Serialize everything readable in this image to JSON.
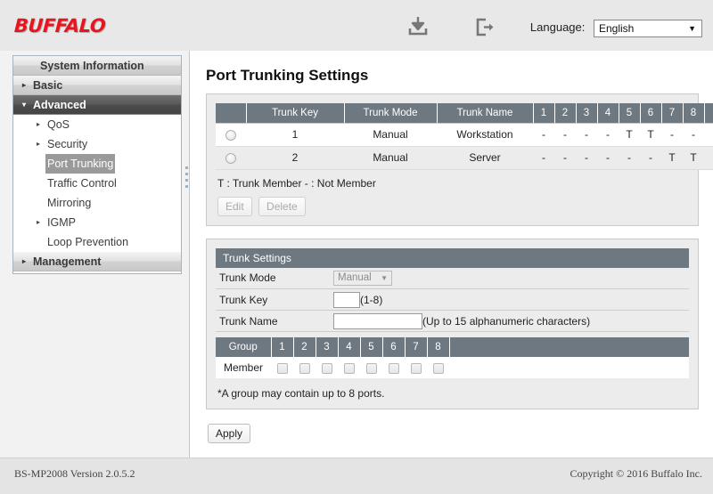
{
  "header": {
    "logo": "BUFFALO",
    "save_icon": "download-icon",
    "logout_icon": "logout-icon",
    "language_label": "Language:",
    "language_value": "English"
  },
  "sidebar": {
    "items": [
      {
        "label": "System Information",
        "type": "top",
        "arrow": "",
        "state": "normal"
      },
      {
        "label": "Basic",
        "type": "top",
        "arrow": "▸",
        "state": "normal"
      },
      {
        "label": "Advanced",
        "type": "top",
        "arrow": "▾",
        "state": "active"
      },
      {
        "label": "QoS",
        "type": "sub",
        "arrow": "▸",
        "state": "normal"
      },
      {
        "label": "Security",
        "type": "sub",
        "arrow": "▸",
        "state": "normal"
      },
      {
        "label": "Port Trunking",
        "type": "sub",
        "arrow": "",
        "state": "selected"
      },
      {
        "label": "Traffic Control",
        "type": "sub",
        "arrow": "",
        "state": "normal"
      },
      {
        "label": "Mirroring",
        "type": "sub",
        "arrow": "",
        "state": "normal"
      },
      {
        "label": "IGMP",
        "type": "sub",
        "arrow": "▸",
        "state": "normal"
      },
      {
        "label": "Loop Prevention",
        "type": "sub",
        "arrow": "",
        "state": "normal"
      },
      {
        "label": "Management",
        "type": "top",
        "arrow": "▸",
        "state": "normal"
      }
    ]
  },
  "page": {
    "title": "Port Trunking Settings"
  },
  "trunk_table": {
    "columns": [
      "",
      "Trunk Key",
      "Trunk Mode",
      "Trunk Name",
      "1",
      "2",
      "3",
      "4",
      "5",
      "6",
      "7",
      "8",
      ""
    ],
    "rows": [
      {
        "selected": false,
        "trunk_key": "1",
        "trunk_mode": "Manual",
        "trunk_name": "Workstation",
        "ports": [
          "-",
          "-",
          "-",
          "-",
          "T",
          "T",
          "-",
          "-"
        ]
      },
      {
        "selected": false,
        "trunk_key": "2",
        "trunk_mode": "Manual",
        "trunk_name": "Server",
        "ports": [
          "-",
          "-",
          "-",
          "-",
          "-",
          "-",
          "T",
          "T"
        ]
      }
    ],
    "legend": "T : Trunk Member - : Not Member",
    "edit_label": "Edit",
    "delete_label": "Delete"
  },
  "trunk_settings": {
    "section_title": "Trunk Settings",
    "mode_label": "Trunk Mode",
    "mode_value": "Manual",
    "key_label": "Trunk Key",
    "key_value": "",
    "key_hint": "(1-8)",
    "name_label": "Trunk Name",
    "name_value": "",
    "name_hint": "(Up to 15 alphanumeric characters)",
    "group_header": "Group",
    "group_ports": [
      "1",
      "2",
      "3",
      "4",
      "5",
      "6",
      "7",
      "8"
    ],
    "member_label": "Member",
    "member_checked": [
      false,
      false,
      false,
      false,
      false,
      false,
      false,
      false
    ],
    "note": "*A group may contain up to 8 ports."
  },
  "apply_label": "Apply",
  "footer": {
    "version": "BS-MP2008 Version 2.0.5.2",
    "copyright": "Copyright © 2016 Buffalo Inc."
  }
}
